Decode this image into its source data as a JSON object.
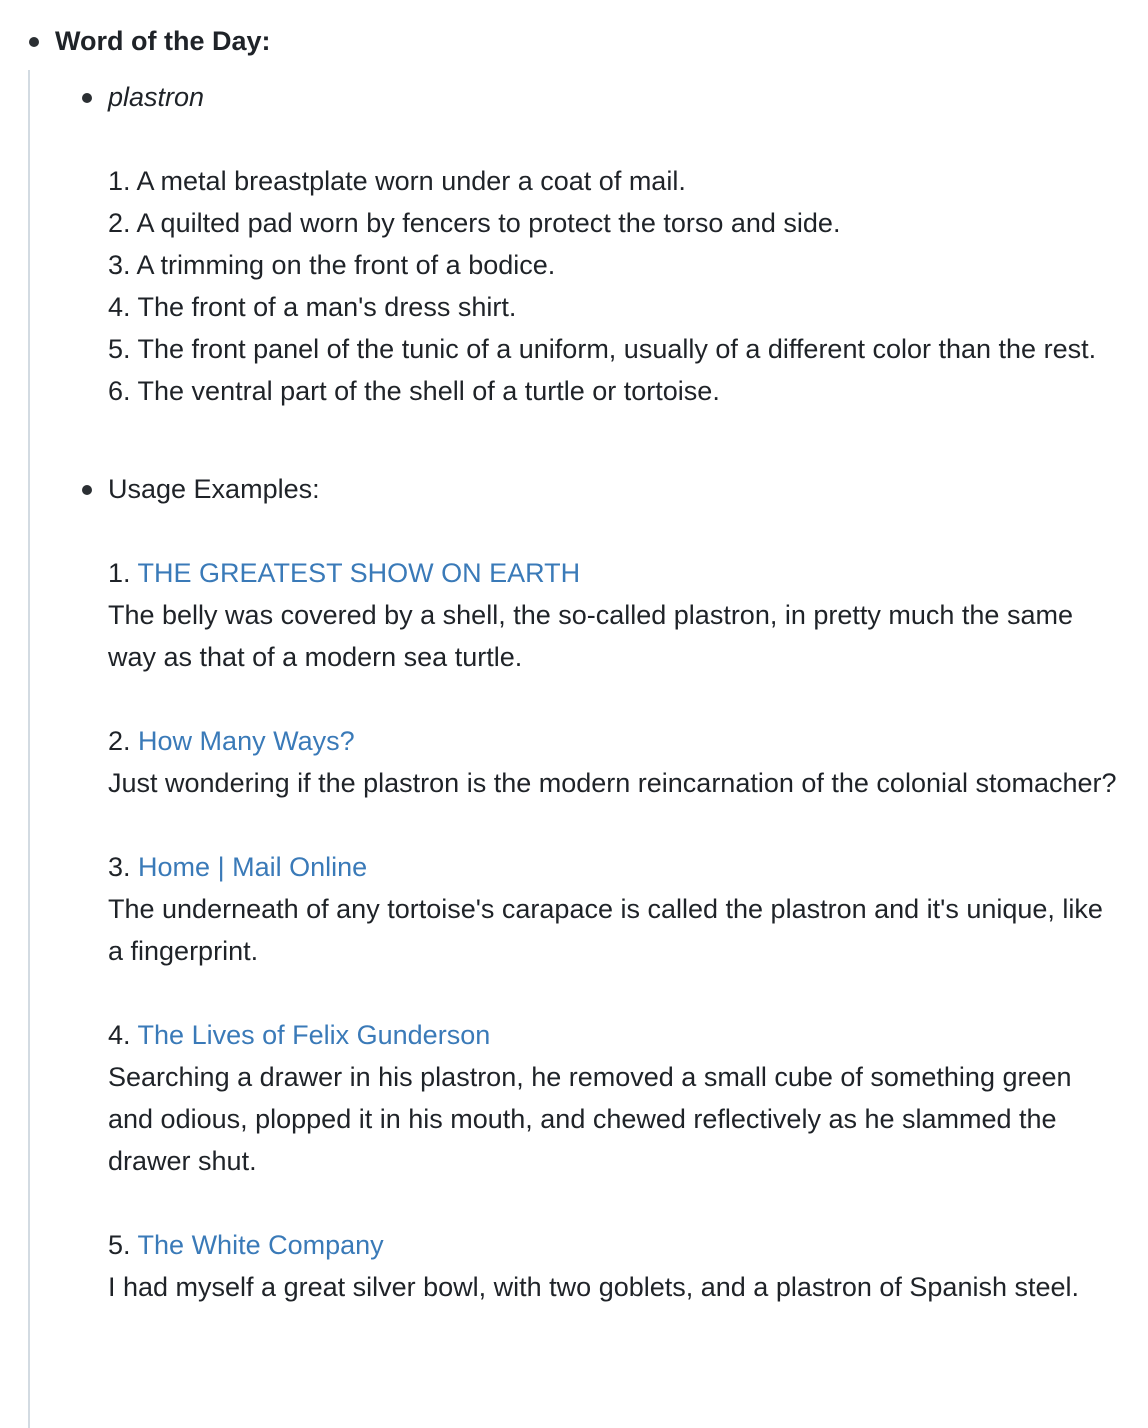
{
  "heading": "Word of the Day:",
  "word": "plastron",
  "definitions": [
    "1. A metal breastplate worn under a coat of mail.",
    "2. A quilted pad worn by fencers to protect the torso and side.",
    "3. A trimming on the front of a bodice.",
    "4. The front of a man's dress shirt.",
    "5. The front panel of the tunic of a uniform, usually of a different color than the rest.",
    "6. The ventral part of the shell of a turtle or tortoise."
  ],
  "usage_label": "Usage Examples:",
  "examples": [
    {
      "number": "1.",
      "source": "THE GREATEST SHOW ON EARTH",
      "text": "The belly was covered by a shell, the so-called plastron, in pretty much the same way as that of a modern sea turtle."
    },
    {
      "number": "2.",
      "source": "How Many Ways?",
      "text": "Just wondering if the plastron is the modern reincarnation of the colonial stomacher?"
    },
    {
      "number": "3.",
      "source": "Home | Mail Online",
      "text": "The underneath of any tortoise's carapace is called the plastron and it's unique, like a fingerprint."
    },
    {
      "number": "4.",
      "source": "The Lives of Felix Gunderson",
      "text": "Searching a drawer in his plastron, he removed a small cube of something green and odious, plopped it in his mouth, and chewed reflectively as he slammed the drawer shut."
    },
    {
      "number": "5.",
      "source": "The White Company",
      "text": "I had myself a great silver bowl, with two goblets, and a plastron of Spanish steel."
    }
  ],
  "colors": {
    "link": "#3a7ab8",
    "text": "#1f2328",
    "guide": "#d3dbe2"
  }
}
